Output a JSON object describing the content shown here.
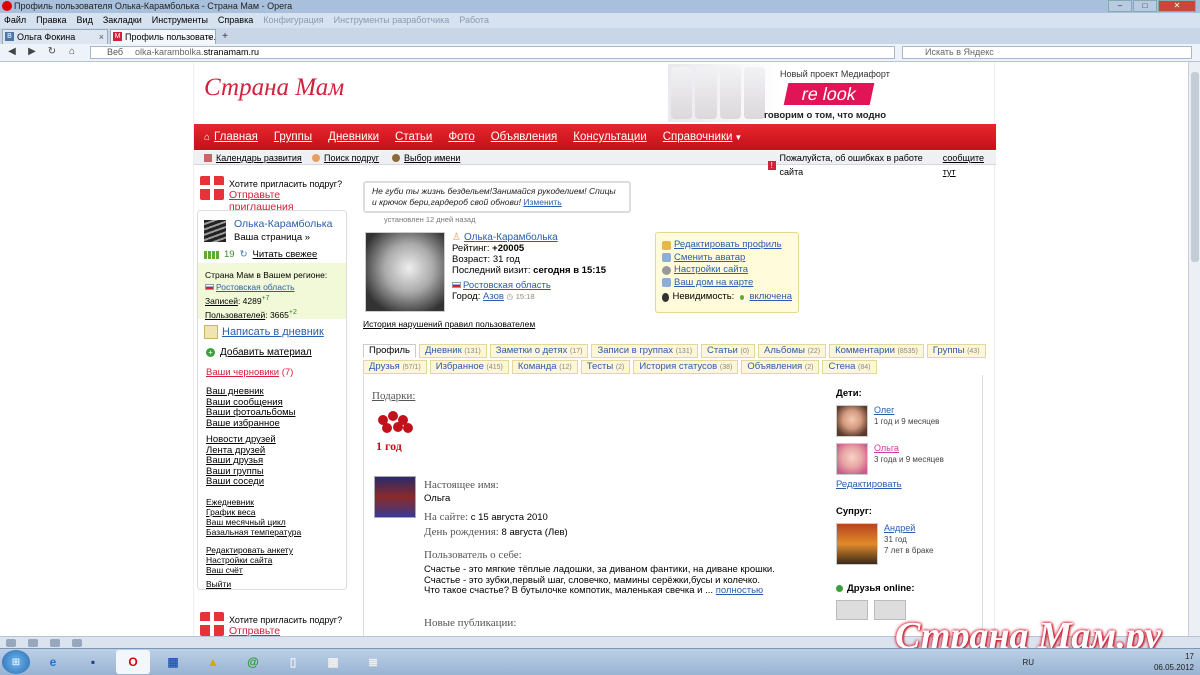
{
  "window": {
    "title": "Профиль пользователя Олька-Карамболька - Страна Мам - Opera"
  },
  "menu": {
    "items": [
      "Файл",
      "Правка",
      "Вид",
      "Закладки",
      "Инструменты",
      "Справка"
    ],
    "faded": [
      "Конфигурация",
      "Инструменты разработчика",
      "Работа"
    ]
  },
  "browser_tabs": [
    {
      "label": "Ольга Фокина",
      "fav": "В",
      "color": "#4a76a8"
    },
    {
      "label": "Профиль пользовате...",
      "fav": "М",
      "color": "#d4203a"
    }
  ],
  "nav": {
    "web_label": "Веб",
    "url_prefix": "olka-karambolka.",
    "url_host": "stranamam.ru",
    "search_placeholder": "Искать в Яндекс"
  },
  "site": {
    "logo": "Страна Мам",
    "banner": {
      "line1": "Новый проект Медиафорт",
      "brand": "re look",
      "line2": "говорим о том, что модно"
    },
    "main_menu": [
      "Главная",
      "Группы",
      "Дневники",
      "Статьи",
      "Фото",
      "Объявления",
      "Консультации",
      "Справочники"
    ],
    "sub_menu": [
      "Календарь развития",
      "Поиск подруг",
      "Выбор имени"
    ],
    "report": {
      "text": "Пожалуйста, об ошибках в работе сайта",
      "link": "сообщите тут"
    }
  },
  "left": {
    "invite_q": "Хотите пригласить подруг?",
    "invite_link": "Отправьте приглашения",
    "username": "Олька-Карамболька",
    "my_page": "Ваша страница »",
    "count": "19",
    "read_fresh": "Читать свежее",
    "region_title": "Страна Мам в Вашем регионе:",
    "region_name": "Ростовская область",
    "posts_label": "Записей",
    "posts_val": "4289",
    "posts_delta": "+7",
    "users_label": "Пользователей",
    "users_val": "3665",
    "users_delta": "+2",
    "write_blog": "Написать в дневник",
    "add_material": "Добавить материал",
    "drafts": "Ваши черновики",
    "drafts_count": "(7)",
    "group1": [
      "Ваш дневник",
      "Ваши сообщения",
      "Ваши фотоальбомы",
      "Ваше избранное"
    ],
    "group2": [
      "Новости друзей",
      "Лента друзей",
      "Ваши друзья",
      "Ваши группы",
      "Ваши соседи"
    ],
    "group3": [
      "Ежедневник",
      "График веса",
      "Ваш месячный цикл",
      "Базальная температура"
    ],
    "group4": [
      "Редактировать анкету",
      "Настройки сайта",
      "Ваш счёт"
    ],
    "logout": "Выйти"
  },
  "profile": {
    "status": "Не губи ты жизнь бездельем!Занимайся рукоделием! Спицы и крючок бери,гардероб свой обнови!",
    "status_edit": "Изменить",
    "status_note": "установлен 12 дней назад",
    "name": "Олька-Карамболька",
    "rating_label": "Рейтинг:",
    "rating": "+20005",
    "age_label": "Возраст:",
    "age": "31 год",
    "visit_label": "Последний визит:",
    "visit": "сегодня в 15:15",
    "region": "Ростовская область",
    "city_label": "Город:",
    "city": "Азов",
    "city_time": "15:18",
    "history": "История нарушений правил пользователем"
  },
  "actions": {
    "items": [
      "Редактировать профиль",
      "Сменить аватар",
      "Настройки сайта",
      "Ваш дом на карте"
    ],
    "invisible_label": "Невидимость:",
    "invisible_val": "включена"
  },
  "tabs_row1": [
    {
      "label": "Профиль",
      "count": ""
    },
    {
      "label": "Дневник",
      "count": "(131)"
    },
    {
      "label": "Заметки о детях",
      "count": "(17)"
    },
    {
      "label": "Записи в группах",
      "count": "(131)"
    },
    {
      "label": "Статьи",
      "count": "(0)"
    },
    {
      "label": "Альбомы",
      "count": "(22)"
    },
    {
      "label": "Комментарии",
      "count": "(8535)"
    },
    {
      "label": "Группы",
      "count": "(43)"
    }
  ],
  "tabs_row2": [
    {
      "label": "Друзья",
      "count": "(57/1)"
    },
    {
      "label": "Избранное",
      "count": "(415)"
    },
    {
      "label": "Команда",
      "count": "(12)"
    },
    {
      "label": "Тесты",
      "count": "(2)"
    },
    {
      "label": "История статусов",
      "count": "(38)"
    },
    {
      "label": "Объявления",
      "count": "(2)"
    },
    {
      "label": "Стена",
      "count": "(84)"
    }
  ],
  "content": {
    "gifts_label": "Подарки:",
    "gift_caption": "1 год",
    "realname_label": "Настоящее имя:",
    "realname": "Ольга",
    "onsite_label": "На сайте:",
    "onsite": "с 15 августа 2010",
    "birthday_label": "День рождения:",
    "birthday": "8 августа (Лев)",
    "about_label": "Пользователь о себе:",
    "about1": "Счастье - это мягкие тёплые ладошки, за диваном фантики, на диване крошки.",
    "about2": "Счастье - это зубки,первый шаг, словечко, мамины серёжки,бусы и колечко.",
    "about3": "Что такое счастье? В бутылочке компотик, маленькая свечка и ...",
    "more": "полностью",
    "new_pubs": "Новые публикации:"
  },
  "family": {
    "kids_label": "Дети:",
    "kids": [
      {
        "name": "Олег",
        "age": "1 год и 9 месяцев"
      },
      {
        "name": "Ольга",
        "age": "3 года и 9 месяцев"
      }
    ],
    "edit": "Редактировать",
    "spouse_label": "Супруг:",
    "spouse_name": "Андрей",
    "spouse_age": "31 год",
    "spouse_married": "7 лет в браке",
    "online_label": "Друзья online:"
  },
  "watermark": "Страна Мам.ру",
  "tray": {
    "lang": "RU",
    "time": "17",
    "date": "06.05.2012"
  }
}
